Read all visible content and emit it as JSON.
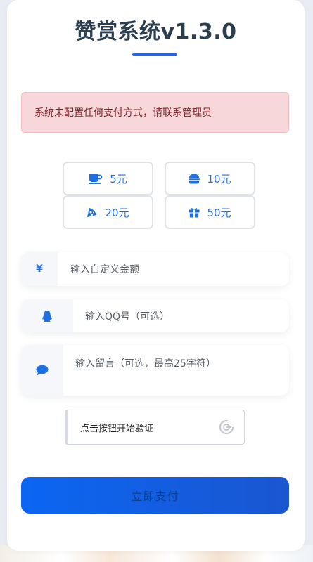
{
  "header": {
    "title": "赞赏系统v1.3.0"
  },
  "alert": {
    "message": "系统未配置任何支付方式，请联系管理员"
  },
  "amounts": [
    {
      "label": "5元",
      "icon": "coffee-icon"
    },
    {
      "label": "10元",
      "icon": "burger-icon"
    },
    {
      "label": "20元",
      "icon": "pizza-icon"
    },
    {
      "label": "50元",
      "icon": "gift-icon"
    }
  ],
  "form": {
    "custom_amount": {
      "symbol": "¥",
      "placeholder": "输入自定义金额"
    },
    "qq": {
      "placeholder": "输入QQ号（可选）",
      "icon": "qq-penguin-icon"
    },
    "message": {
      "placeholder": "输入留言（可选，最高25字符）",
      "icon": "comment-icon"
    }
  },
  "captcha": {
    "label": "点击按钮开始验证",
    "icon": "captcha-logo-icon"
  },
  "pay": {
    "label": "立即支付"
  },
  "colors": {
    "accent": "#1e6fe0",
    "alert_bg": "#f8d7da",
    "pay_bg": "#0b66f2"
  }
}
